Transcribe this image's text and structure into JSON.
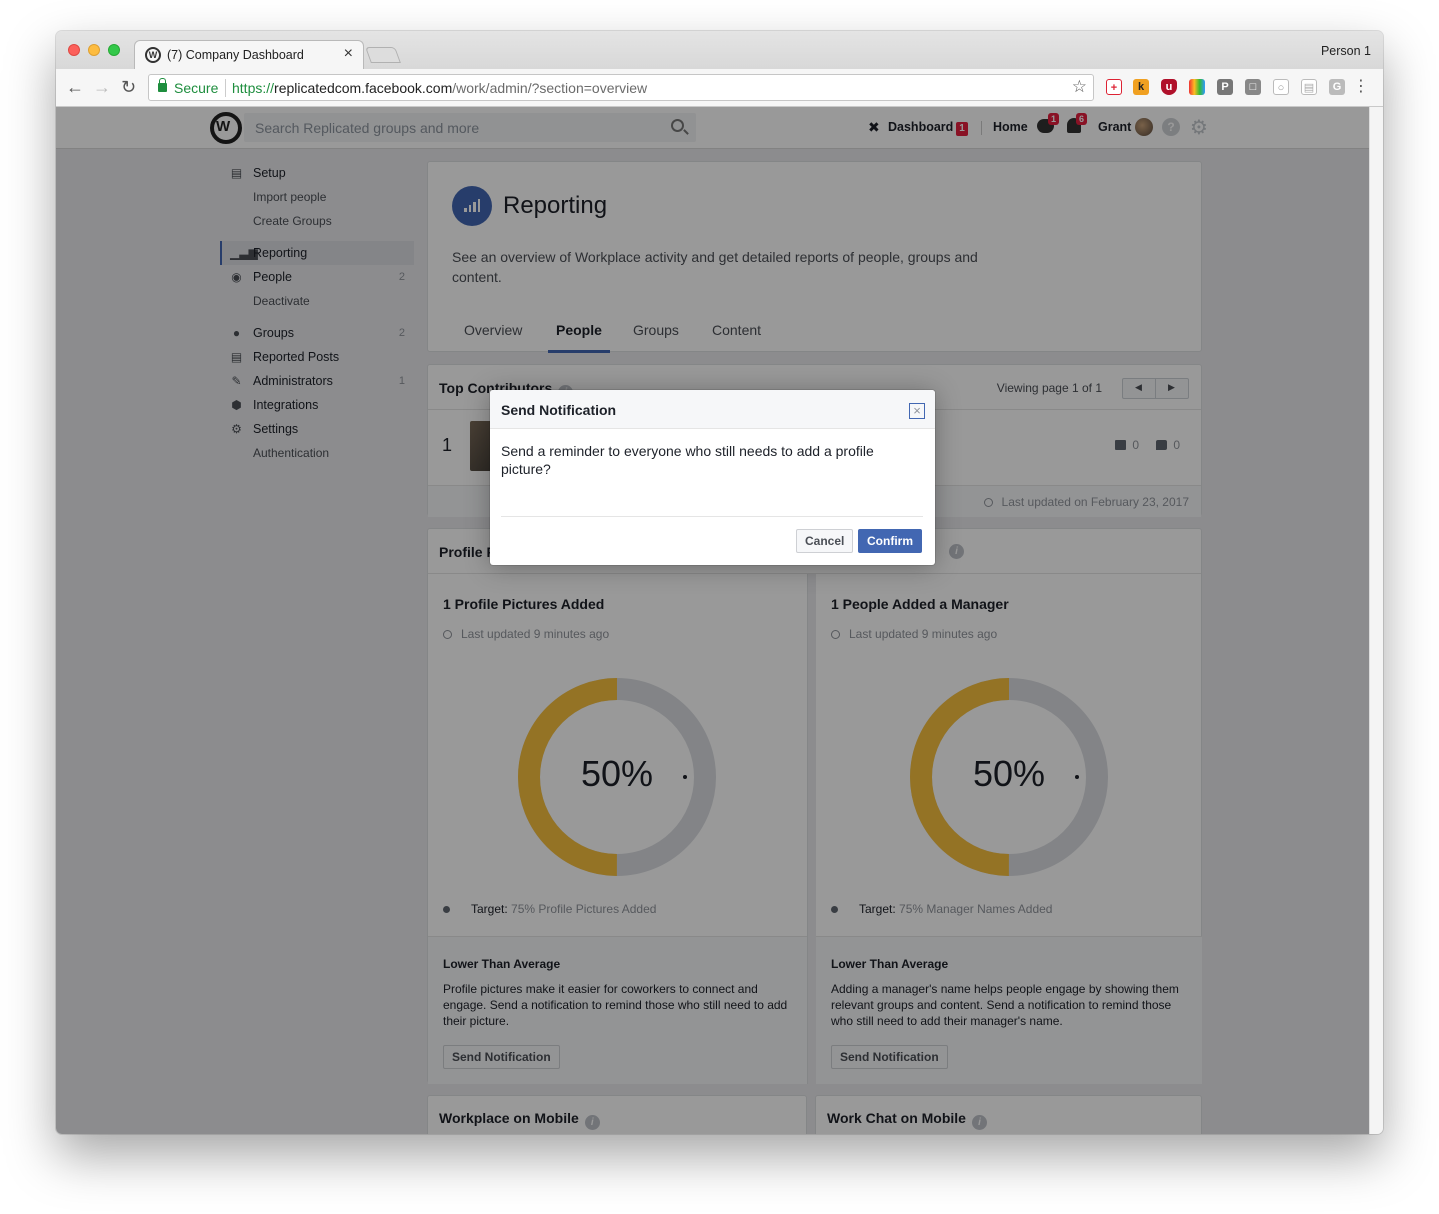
{
  "browser": {
    "tab_title": "(7) Company Dashboard",
    "tab_close": "×",
    "profile_name": "Person 1",
    "secure_label": "Secure",
    "url_scheme": "https://",
    "url_host": "replicatedcom.facebook.com",
    "url_path": "/work/admin/?section=overview",
    "extensions": [
      "plus-ext-icon",
      "k-ext-icon",
      "ublock-ext-icon",
      "rainbow-ext-icon",
      "p-ext-icon",
      "note-ext-icon",
      "circle-ext-icon",
      "box-ext-icon",
      "g-ext-icon"
    ]
  },
  "topbar": {
    "search_placeholder": "Search Replicated groups and more",
    "dashboard_label": "Dashboard",
    "dashboard_count": "1",
    "home_label": "Home",
    "messages_count": "1",
    "notifications_count": "6",
    "user_name": "Grant",
    "help_glyph": "?"
  },
  "sidebar": {
    "items": [
      {
        "label": "Setup",
        "icon": "monitor-icon",
        "count": "",
        "type": "main"
      },
      {
        "label": "Import people",
        "icon": "",
        "count": "",
        "type": "sub"
      },
      {
        "label": "Create Groups",
        "icon": "",
        "count": "",
        "type": "sub"
      },
      {
        "label": "Reporting",
        "icon": "bar-chart-icon",
        "count": "",
        "type": "active"
      },
      {
        "label": "People",
        "icon": "people-icon",
        "count": "2",
        "type": "main"
      },
      {
        "label": "Deactivate",
        "icon": "",
        "count": "",
        "type": "sub"
      },
      {
        "label": "Groups",
        "icon": "groups-icon",
        "count": "2",
        "type": "main"
      },
      {
        "label": "Reported Posts",
        "icon": "reported-posts-icon",
        "count": "",
        "type": "main"
      },
      {
        "label": "Administrators",
        "icon": "wrench-icon",
        "count": "1",
        "type": "main"
      },
      {
        "label": "Integrations",
        "icon": "cube-icon",
        "count": "",
        "type": "main"
      },
      {
        "label": "Settings",
        "icon": "gear-icon",
        "count": "",
        "type": "main"
      },
      {
        "label": "Authentication",
        "icon": "",
        "count": "",
        "type": "sub"
      }
    ]
  },
  "reporting": {
    "title": "Reporting",
    "description": "See an overview of Workplace activity and get detailed reports of people, groups and content.",
    "tabs": [
      {
        "label": "Overview",
        "active": false
      },
      {
        "label": "People",
        "active": true
      },
      {
        "label": "Groups",
        "active": false
      },
      {
        "label": "Content",
        "active": false
      }
    ]
  },
  "top_contributors": {
    "title": "Top Contributors",
    "pager_text": "Viewing page 1 of 1",
    "rank": "1",
    "posts": "0",
    "comments": "0",
    "updated": "Last updated on February 23, 2017"
  },
  "profile_card": {
    "title": "Profile F",
    "metrics": [
      {
        "title": "1 Profile Pictures Added",
        "updated_prefix": "Last updated",
        "updated_ago": "9 minutes ago",
        "percent": 50,
        "percent_label": "50%",
        "target_label": "Target:",
        "target_value": "75% Profile Pictures Added",
        "footer_title": "Lower Than Average",
        "footer_text": "Profile pictures make it easier for coworkers to connect and engage. Send a notification to remind those who still need to add their picture.",
        "button": "Send Notification"
      },
      {
        "title": "1 People Added a Manager",
        "updated_prefix": "Last updated",
        "updated_ago": "9 minutes ago",
        "percent": 50,
        "percent_label": "50%",
        "target_label": "Target:",
        "target_value": "75% Manager Names Added",
        "footer_title": "Lower Than Average",
        "footer_text": "Adding a manager's name helps people engage by showing them relevant groups and content. Send a notification to remind those who still need to add their manager's name.",
        "button": "Send Notification"
      }
    ]
  },
  "mobile": {
    "workplace_title": "Workplace on Mobile",
    "workchat_title": "Work Chat on Mobile"
  },
  "dialog": {
    "title": "Send Notification",
    "close_glyph": "×",
    "body": "Send a reminder to everyone who still needs to add a profile picture?",
    "cancel": "Cancel",
    "confirm": "Confirm"
  },
  "colors": {
    "accent": "#4267b2",
    "donut_fill": "#f7c03e",
    "donut_track": "#dadde1"
  }
}
